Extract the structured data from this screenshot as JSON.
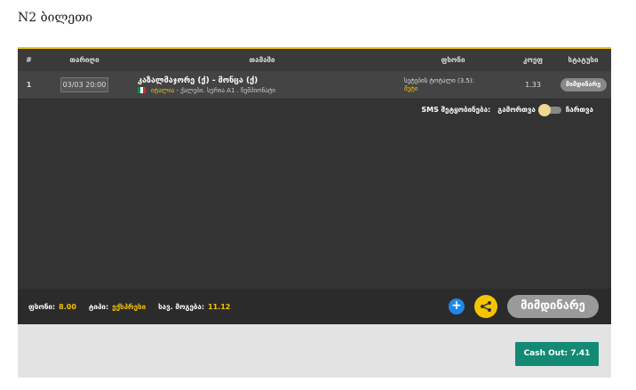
{
  "ticket": {
    "title": "N2 ბილეთი"
  },
  "table": {
    "headers": [
      "#",
      "თარიღი",
      "თამაში",
      "ფსონი",
      "კოეფ",
      "სტატუსი"
    ],
    "row": {
      "num": "1",
      "date": "03/03 20:00",
      "teams": "კაზალმაჯორე (ქ) - მონცა (ქ)",
      "country": "იტალია",
      "league": "- ქალები. სერია A1 . ჩემპიონატი",
      "market": "სეტების ტოტალი (3.5):",
      "pick": "მეტი",
      "odds": "1.33",
      "status": "მიმდინარე"
    }
  },
  "sms": {
    "label": "SMS შეტყობინება:",
    "off_label": "გამორთვა",
    "on_label": "ჩართვა"
  },
  "footer": {
    "stake_label": "ფსონი:",
    "stake_value": "8.00",
    "type_label": "ტიპი:",
    "type_value": "ექსპრესი",
    "win_label": "სავ. მოგება:",
    "win_value": "11.12",
    "plus_symbol": "+",
    "status_button": "მიმდინარე"
  },
  "cashout": {
    "label": "Cash Out: 7.41"
  },
  "colors": {
    "accent": "#f5c400",
    "panel": "#333333",
    "cashout": "#138a74",
    "plus": "#1e88e5"
  }
}
